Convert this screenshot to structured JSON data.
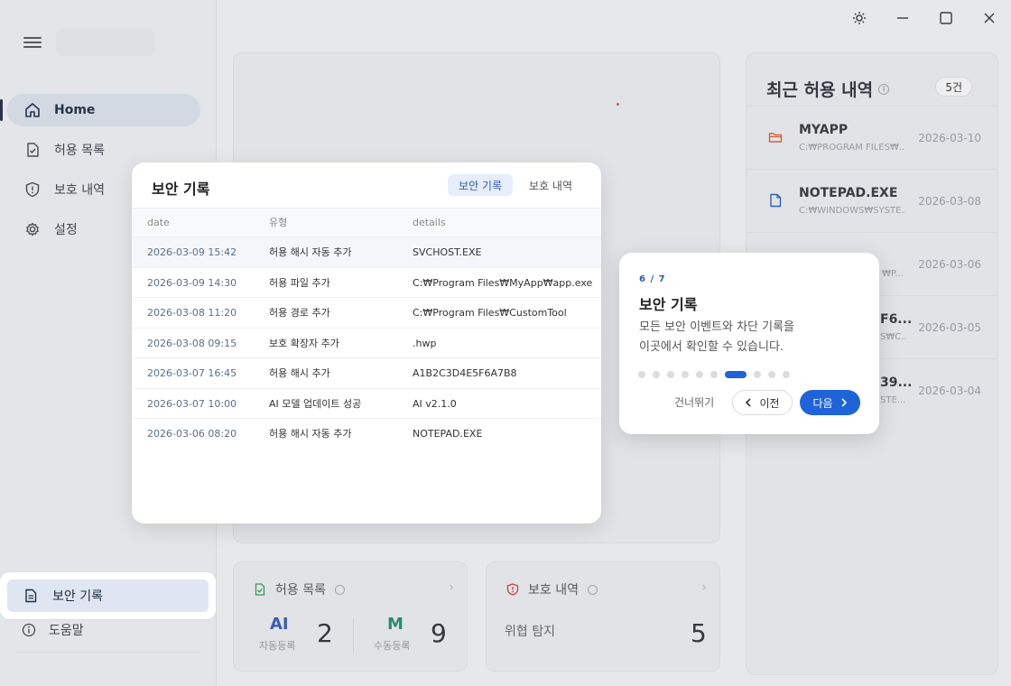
{
  "sidebar": {
    "items": [
      {
        "label": "Home",
        "icon": "home-icon"
      },
      {
        "label": "허용 목록",
        "icon": "file-check-icon"
      },
      {
        "label": "보호 내역",
        "icon": "shield-icon"
      },
      {
        "label": "설정",
        "icon": "gear-icon"
      }
    ],
    "highlighted_item": {
      "label": "보안 기록",
      "icon": "document-icon"
    },
    "help": {
      "label": "도움말",
      "icon": "info-icon"
    }
  },
  "recent": {
    "title": "최근 허용 내역",
    "count": "5건",
    "items": [
      {
        "name": "MYAPP",
        "path": "C:₩PROGRAM FILES₩...",
        "date": "2026-03-10",
        "icon": "folder-icon"
      },
      {
        "name": "NOTEPAD.EXE",
        "path": "C:₩WINDOWS₩SYSTE...",
        "date": "2026-03-08",
        "icon": "file-icon"
      },
      {
        "name": "",
        "path": "₩P...",
        "date": "2026-03-06",
        "icon": ""
      },
      {
        "name": "F6...",
        "path": "S₩C...",
        "date": "2026-03-05",
        "icon": ""
      },
      {
        "name": "39...",
        "path": "STE...",
        "date": "2026-03-04",
        "icon": ""
      }
    ]
  },
  "stats": {
    "allow": {
      "title": "허용 목록",
      "ai_letter": "AI",
      "ai_sub": "자동등록",
      "ai_value": "2",
      "m_letter": "M",
      "m_sub": "수동등록",
      "m_value": "9"
    },
    "protect": {
      "title": "보호 내역",
      "label": "위협 탐지",
      "value": "5"
    }
  },
  "modal": {
    "title": "보안 기록",
    "tabs": [
      "보안 기록",
      "보호 내역"
    ],
    "columns": [
      "date",
      "유형",
      "details"
    ],
    "rows": [
      [
        "2026-03-09 15:42",
        "허용 해시 자동 추가",
        "SVCHOST.EXE"
      ],
      [
        "2026-03-09 14:30",
        "허용 파일 추가",
        "C:₩Program Files₩MyApp₩app.exe"
      ],
      [
        "2026-03-08 11:20",
        "허용 경로 추가",
        "C:₩Program Files₩CustomTool"
      ],
      [
        "2026-03-08 09:15",
        "보호 확장자 추가",
        ".hwp"
      ],
      [
        "2026-03-07 16:45",
        "허용 해시 추가",
        "A1B2C3D4E5F6A7B8"
      ],
      [
        "2026-03-07 10:00",
        "AI 모델 업데이트 성공",
        "AI v2.1.0"
      ],
      [
        "2026-03-06 08:20",
        "허용 해시 자동 추가",
        "NOTEPAD.EXE"
      ]
    ]
  },
  "tour": {
    "step": "6 / 7",
    "title": "보안 기록",
    "text_line1": "모든 보안 이벤트와 차단 기록을",
    "text_line2": "이곳에서 확인할 수 있습니다.",
    "dots_total": 10,
    "dot_active": 6,
    "skip": "건너뛰기",
    "prev": "이전",
    "next": "다음"
  },
  "colors": {
    "accent": "#1f63d8",
    "ai": "#3559b8",
    "manual": "#1e8c6a",
    "danger": "#d23b3b",
    "doc_green": "#2e9b5a"
  }
}
